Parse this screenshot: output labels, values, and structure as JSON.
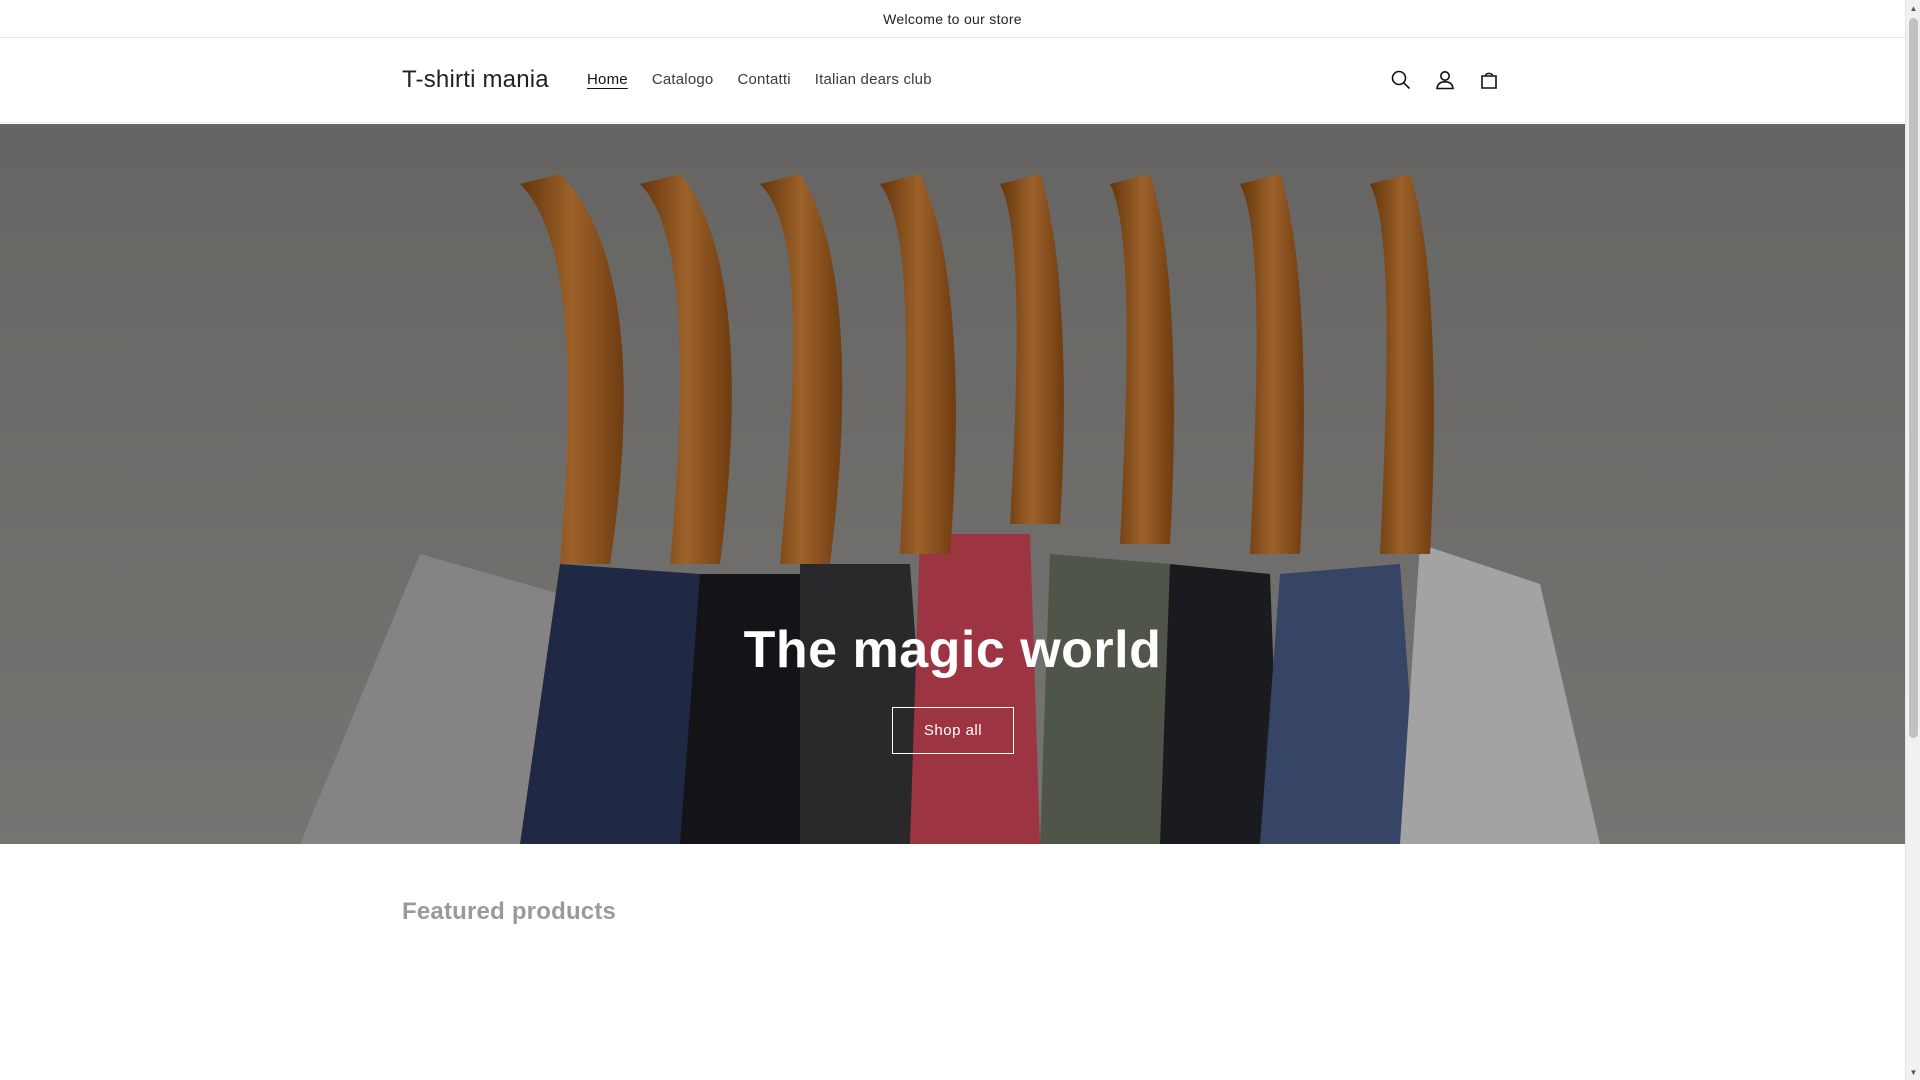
{
  "announcement": {
    "text": "Welcome to our store"
  },
  "header": {
    "brand": "T-shirti mania",
    "nav": [
      {
        "label": "Home",
        "active": true
      },
      {
        "label": "Catalogo",
        "active": false
      },
      {
        "label": "Contatti",
        "active": false
      },
      {
        "label": "Italian dears club",
        "active": false
      }
    ],
    "icons": [
      "search-icon",
      "account-icon",
      "cart-icon"
    ]
  },
  "hero": {
    "title": "The magic world",
    "button_label": "Shop all"
  },
  "featured": {
    "title": "Featured products"
  },
  "colors": {
    "text": "#121212",
    "muted": "#9a9a9a",
    "hero_text": "#ffffff"
  }
}
